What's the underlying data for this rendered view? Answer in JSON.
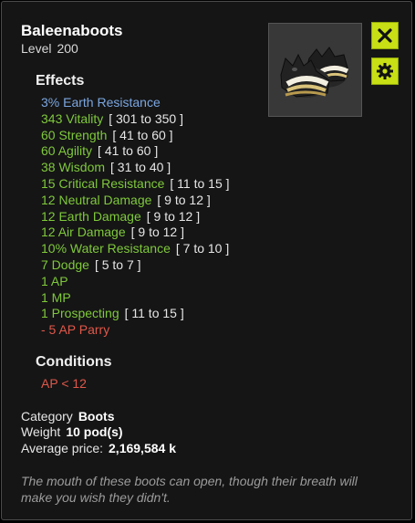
{
  "item": {
    "name": "Baleenaboots",
    "level_label": "Level",
    "level_value": "200"
  },
  "effects_title": "Effects",
  "effects": [
    {
      "text": "3% Earth Resistance",
      "range": "",
      "color": "blue"
    },
    {
      "text": "343 Vitality",
      "range": "[ 301 to 350 ]",
      "color": "green"
    },
    {
      "text": "60 Strength",
      "range": "[ 41 to 60 ]",
      "color": "green"
    },
    {
      "text": "60 Agility",
      "range": "[ 41 to 60 ]",
      "color": "green"
    },
    {
      "text": "38 Wisdom",
      "range": "[ 31 to 40 ]",
      "color": "green"
    },
    {
      "text": "15 Critical Resistance",
      "range": "[ 11 to 15 ]",
      "color": "green"
    },
    {
      "text": "12 Neutral Damage",
      "range": "[ 9 to 12 ]",
      "color": "green"
    },
    {
      "text": "12 Earth Damage",
      "range": "[ 9 to 12 ]",
      "color": "green"
    },
    {
      "text": "12 Air Damage",
      "range": "[ 9 to 12 ]",
      "color": "green"
    },
    {
      "text": "10% Water Resistance",
      "range": "[ 7 to 10 ]",
      "color": "green"
    },
    {
      "text": "7 Dodge",
      "range": "[ 5 to 7 ]",
      "color": "green"
    },
    {
      "text": "1 AP",
      "range": "",
      "color": "green"
    },
    {
      "text": "1 MP",
      "range": "",
      "color": "green"
    },
    {
      "text": "1 Prospecting",
      "range": "[ 11 to 15 ]",
      "color": "green"
    },
    {
      "text": "- 5 AP Parry",
      "range": "",
      "color": "red"
    }
  ],
  "conditions_title": "Conditions",
  "condition": "AP < 12",
  "info": {
    "category_label": "Category",
    "category_value": "Boots",
    "weight_label": "Weight",
    "weight_value": "10 pod(s)",
    "price_label": "Average price:",
    "price_value": "2,169,584 k"
  },
  "description": "The mouth of these boots can open, though their breath will make you wish they didn't.",
  "icons": {
    "close": "close-icon",
    "settings": "gear-icon",
    "item": "boots-item-icon"
  },
  "colors": {
    "accent_button": "#c7df14",
    "effect_green": "#7fc93c",
    "effect_blue": "#7ba6e0",
    "effect_red": "#e0584a",
    "panel_bg": "#151515"
  }
}
